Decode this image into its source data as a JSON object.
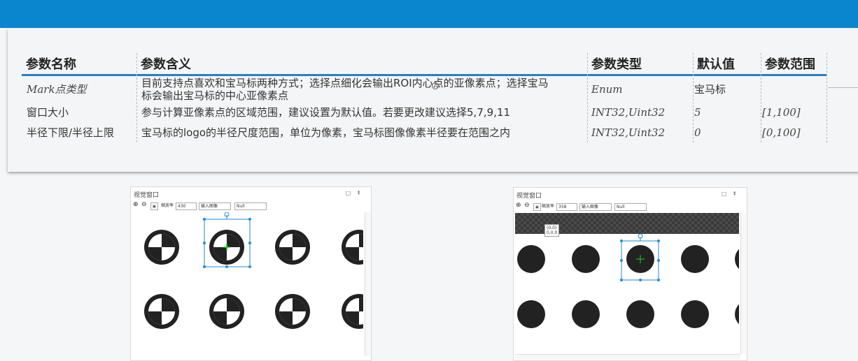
{
  "table": {
    "headers": [
      "参数名称",
      "参数含义",
      "参数类型",
      "默认值",
      "参数范围"
    ],
    "rows": [
      {
        "name": "Mark点类型",
        "meaning_line1": "目前支持点喜欢和宝马标两种方式；选择点细化会输出ROI内心点的亚像素点；选择宝马",
        "meaning_line2": "标会输出宝马标的中心亚像素点",
        "type": "Enum",
        "default": "宝马标",
        "range": ""
      },
      {
        "name": "窗口大小",
        "meaning_line1": "参与计算亚像素点的区域范围，建议设置为默认值。若要更改建议选择5,7,9,11",
        "type": "INT32,Uint32",
        "default": "5",
        "range": "[1,100]"
      },
      {
        "name": "半径下限/半径上限",
        "meaning_line1": "宝马标的logo的半径尺度范围，单位为像素，宝马标图像像素半径要在范围之内",
        "type": "INT32,Uint32",
        "default": "0",
        "range": "[0,100]"
      }
    ]
  },
  "left_window": {
    "title": "视觉窗口",
    "zoom_label": "缩放率",
    "zoom_value": "430",
    "source_select": "输入图像",
    "mode_select": "Null"
  },
  "right_window": {
    "title": "视觉窗口",
    "zoom_label": "缩放率",
    "zoom_value": "358",
    "source_select": "输入图像",
    "mode_select": "Null",
    "tooltip_line1": "(0,0)",
    "tooltip_line2": "0,0,0"
  },
  "colors": {
    "topbar": "#0a86cf",
    "header_rule": "#2b7fc2",
    "selection": "#1e8ad8",
    "center_marker": "#19d219"
  }
}
